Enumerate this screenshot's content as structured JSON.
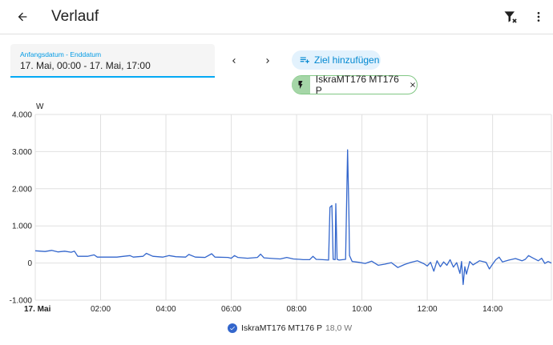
{
  "header": {
    "title": "Verlauf",
    "back_icon": "arrow-left-icon",
    "filter_icon": "filter-remove-icon",
    "menu_icon": "dots-vertical-icon"
  },
  "date_picker": {
    "label": "Anfangsdatum - Enddatum",
    "value": "17. Mai, 00:00 - 17. Mai, 17:00"
  },
  "target": {
    "add_label": "Ziel hinzufügen",
    "chip_label": "IskraMT176 MT176 P"
  },
  "colors": {
    "accent": "#03a9f4",
    "series": "#3366cc",
    "chip_border": "#81c784",
    "chip_icon_bg": "#a5d6a7"
  },
  "chart_data": {
    "type": "line",
    "ylabel": "W",
    "y_ticks": [
      "4.000",
      "3.000",
      "2.000",
      "1.000",
      "0",
      "-1.000"
    ],
    "x_ticks": [
      "17. Mai",
      "02:00",
      "04:00",
      "06:00",
      "08:00",
      "10:00",
      "12:00",
      "14:00"
    ],
    "ylim": [
      -1000,
      4000
    ],
    "xlim_hours": [
      0,
      15.8
    ],
    "grid": true,
    "legend_position": "bottom",
    "series": [
      {
        "name": "IskraMT176 MT176 P",
        "state": "18,0 W",
        "points": [
          [
            0.0,
            330
          ],
          [
            0.3,
            310
          ],
          [
            0.5,
            340
          ],
          [
            0.7,
            300
          ],
          [
            0.9,
            320
          ],
          [
            1.1,
            290
          ],
          [
            1.2,
            320
          ],
          [
            1.3,
            180
          ],
          [
            1.6,
            180
          ],
          [
            1.8,
            220
          ],
          [
            1.9,
            160
          ],
          [
            2.5,
            160
          ],
          [
            2.6,
            170
          ],
          [
            2.9,
            200
          ],
          [
            3.0,
            160
          ],
          [
            3.3,
            180
          ],
          [
            3.4,
            260
          ],
          [
            3.6,
            180
          ],
          [
            3.9,
            160
          ],
          [
            4.1,
            200
          ],
          [
            4.3,
            170
          ],
          [
            4.6,
            160
          ],
          [
            4.7,
            230
          ],
          [
            4.9,
            160
          ],
          [
            5.2,
            150
          ],
          [
            5.4,
            250
          ],
          [
            5.5,
            160
          ],
          [
            5.9,
            150
          ],
          [
            6.0,
            130
          ],
          [
            6.1,
            200
          ],
          [
            6.2,
            150
          ],
          [
            6.5,
            130
          ],
          [
            6.8,
            150
          ],
          [
            6.9,
            240
          ],
          [
            7.0,
            140
          ],
          [
            7.3,
            120
          ],
          [
            7.5,
            110
          ],
          [
            7.7,
            150
          ],
          [
            7.9,
            110
          ],
          [
            8.1,
            100
          ],
          [
            8.2,
            90
          ],
          [
            8.4,
            90
          ],
          [
            8.5,
            180
          ],
          [
            8.6,
            100
          ],
          [
            8.8,
            90
          ],
          [
            8.98,
            80
          ],
          [
            9.02,
            1500
          ],
          [
            9.08,
            1550
          ],
          [
            9.12,
            100
          ],
          [
            9.18,
            90
          ],
          [
            9.2,
            1600
          ],
          [
            9.24,
            100
          ],
          [
            9.3,
            80
          ],
          [
            9.5,
            100
          ],
          [
            9.56,
            3050
          ],
          [
            9.6,
            1400
          ],
          [
            9.62,
            200
          ],
          [
            9.7,
            40
          ],
          [
            9.9,
            20
          ],
          [
            10.1,
            -10
          ],
          [
            10.3,
            50
          ],
          [
            10.5,
            -60
          ],
          [
            10.7,
            -30
          ],
          [
            10.9,
            10
          ],
          [
            11.1,
            -120
          ],
          [
            11.3,
            -40
          ],
          [
            11.5,
            20
          ],
          [
            11.7,
            60
          ],
          [
            11.9,
            -20
          ],
          [
            12.0,
            -80
          ],
          [
            12.1,
            20
          ],
          [
            12.2,
            -220
          ],
          [
            12.3,
            60
          ],
          [
            12.4,
            -100
          ],
          [
            12.5,
            30
          ],
          [
            12.6,
            -60
          ],
          [
            12.7,
            90
          ],
          [
            12.8,
            -110
          ],
          [
            12.9,
            10
          ],
          [
            13.0,
            -280
          ],
          [
            13.05,
            40
          ],
          [
            13.1,
            -580
          ],
          [
            13.15,
            -100
          ],
          [
            13.2,
            -300
          ],
          [
            13.3,
            40
          ],
          [
            13.4,
            -50
          ],
          [
            13.6,
            60
          ],
          [
            13.8,
            20
          ],
          [
            13.9,
            -160
          ],
          [
            14.0,
            -30
          ],
          [
            14.1,
            90
          ],
          [
            14.2,
            160
          ],
          [
            14.3,
            30
          ],
          [
            14.5,
            80
          ],
          [
            14.7,
            120
          ],
          [
            14.9,
            60
          ],
          [
            15.0,
            100
          ],
          [
            15.1,
            200
          ],
          [
            15.2,
            150
          ],
          [
            15.4,
            60
          ],
          [
            15.5,
            130
          ],
          [
            15.6,
            -10
          ],
          [
            15.7,
            40
          ],
          [
            15.8,
            0
          ]
        ]
      }
    ]
  }
}
